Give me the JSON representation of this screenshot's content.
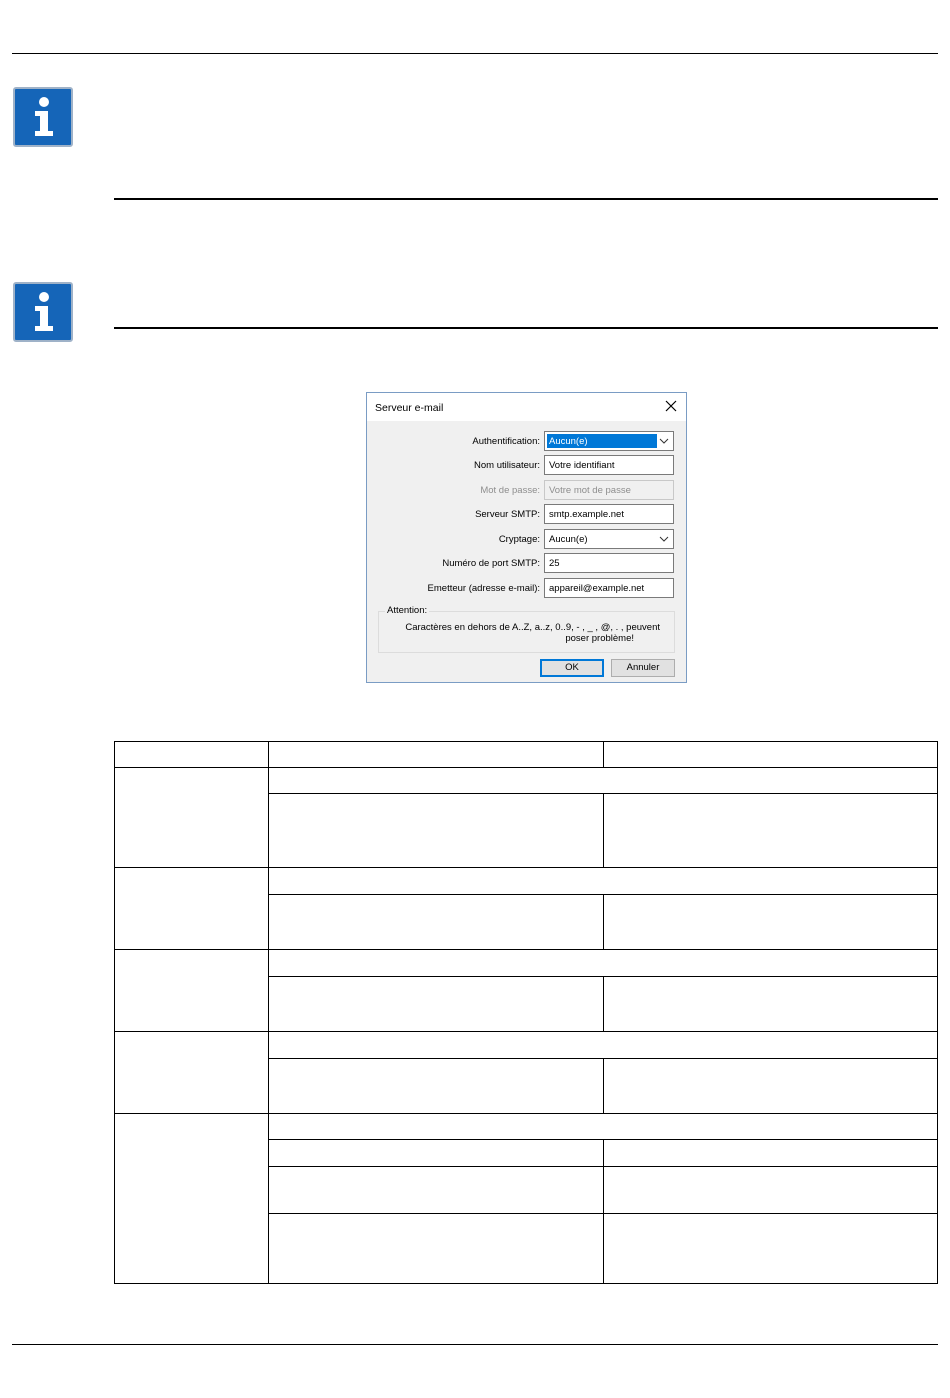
{
  "dialog": {
    "title": "Serveur e-mail",
    "fields": [
      {
        "label": "Authentification:",
        "value": "Aucun(e)",
        "type": "select",
        "selected": true
      },
      {
        "label": "Nom utilisateur:",
        "value": "Votre identifiant",
        "type": "text"
      },
      {
        "label": "Mot de passe:",
        "value": "Votre mot de passe",
        "type": "text",
        "disabled": true
      },
      {
        "label": "Serveur SMTP:",
        "value": "smtp.example.net",
        "type": "text"
      },
      {
        "label": "Cryptage:",
        "value": "Aucun(e)",
        "type": "select"
      },
      {
        "label": "Numéro de port SMTP:",
        "value": "25",
        "type": "text"
      },
      {
        "label": "Emetteur (adresse e-mail):",
        "value": "appareil@example.net",
        "type": "text"
      }
    ],
    "attention": {
      "legend": "Attention:",
      "line1": "Caractères en dehors de A..Z, a..z, 0..9, - , _ , @, . , peuvent",
      "line2": "poser problème!"
    },
    "ok_label": "OK",
    "cancel_label": "Annuler"
  },
  "colors": {
    "info_icon": "#1565b8",
    "selection": "#0078d7",
    "dialog_border": "#7a9cc4"
  }
}
